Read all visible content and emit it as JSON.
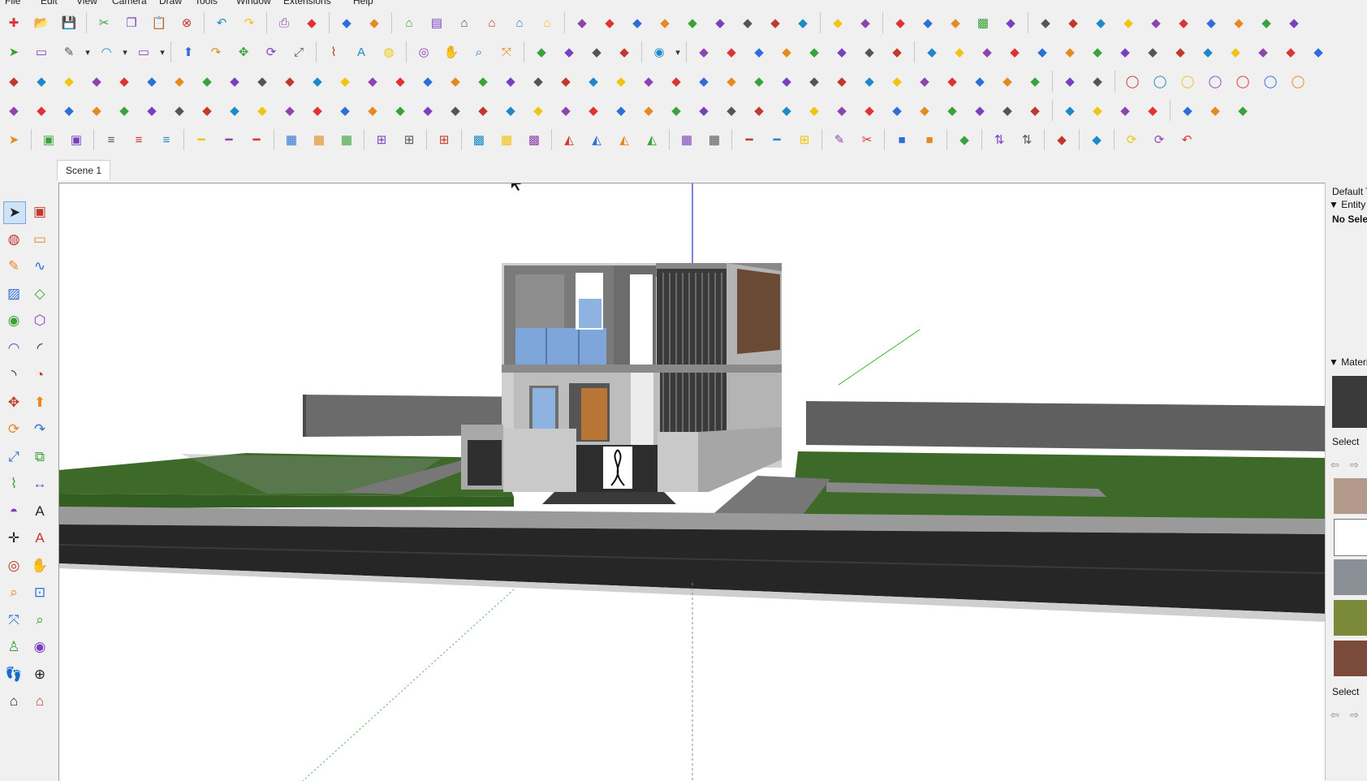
{
  "menu": [
    "File",
    "Edit",
    "View",
    "Camera",
    "Draw",
    "Tools",
    "Window",
    "Extensions",
    "Help"
  ],
  "scene_tab": "Scene 1",
  "toolbars": {
    "row1": [
      "new-file",
      "open-folder",
      "save",
      "|",
      "cut",
      "copy",
      "paste",
      "erase",
      "|",
      "undo",
      "redo",
      "|",
      "print",
      "model-info",
      "|",
      "geo-location",
      "photo-texture",
      "|",
      "iso-view",
      "top-view",
      "front-view",
      "right-view",
      "back-view",
      "left-view",
      "|",
      "extension-tool",
      "extension-tool",
      "extension-tool",
      "extension-tool",
      "extension-tool",
      "extension-tool",
      "extension-tool",
      "extension-tool",
      "extension-tool",
      "|",
      "warehouse",
      "extension-warehouse",
      "|",
      "layout",
      "style-builder",
      "solid-tools",
      "texture",
      "section",
      "|",
      "shape-tool",
      "shape-tool",
      "shape-tool",
      "shape-tool",
      "shape-tool",
      "shape-tool",
      "shape-tool",
      "shape-tool",
      "shape-tool",
      "shape-tool"
    ],
    "row2": [
      "select",
      "eraser",
      "pencil",
      "dropdown",
      "arc",
      "dropdown",
      "rectangle",
      "dropdown",
      "|",
      "push-pull",
      "follow-me",
      "move",
      "rotate",
      "scale",
      "|",
      "tape-measure",
      "text",
      "paint-bucket",
      "|",
      "orbit",
      "pan",
      "zoom",
      "zoom-extents",
      "|",
      "warehouse",
      "extension-warehouse",
      "layout",
      "ruby",
      "|",
      "user",
      "dropdown",
      "|",
      "fredo-tool",
      "fredo-tool",
      "fredo-tool",
      "fredo-tool",
      "fredo-tool",
      "fredo-tool",
      "fredo-tool",
      "fredo-tool",
      "|",
      "curve-tool",
      "curve-tool",
      "curve-tool",
      "curve-tool",
      "curve-tool",
      "curve-tool",
      "curve-tool",
      "curve-tool",
      "curve-tool",
      "curve-tool",
      "curve-tool",
      "curve-tool",
      "curve-tool",
      "curve-tool",
      "curve-tool"
    ],
    "row3": [
      "plugin",
      "plugin",
      "plugin",
      "plugin",
      "plugin",
      "plugin",
      "plugin",
      "plugin",
      "plugin",
      "plugin",
      "plugin",
      "plugin",
      "plugin",
      "plugin",
      "plugin",
      "plugin",
      "plugin",
      "plugin",
      "plugin",
      "plugin",
      "plugin",
      "plugin",
      "plugin",
      "plugin",
      "plugin",
      "plugin",
      "plugin",
      "plugin",
      "plugin",
      "plugin",
      "plugin",
      "plugin",
      "plugin",
      "plugin",
      "plugin",
      "plugin",
      "plugin",
      "plugin",
      "|",
      "plugin",
      "plugin",
      "|",
      "shape",
      "shape",
      "shape",
      "shape",
      "shape",
      "shape",
      "shape"
    ],
    "row4": [
      "plugin",
      "plugin",
      "plugin",
      "plugin",
      "plugin",
      "plugin",
      "plugin",
      "plugin",
      "plugin",
      "plugin",
      "plugin",
      "plugin",
      "plugin",
      "plugin",
      "plugin",
      "plugin",
      "plugin",
      "plugin",
      "plugin",
      "plugin",
      "plugin",
      "plugin",
      "plugin",
      "plugin",
      "plugin",
      "plugin",
      "plugin",
      "plugin",
      "plugin",
      "plugin",
      "plugin",
      "plugin",
      "plugin",
      "plugin",
      "plugin",
      "plugin",
      "plugin",
      "plugin",
      "|",
      "plugin",
      "plugin",
      "plugin",
      "plugin",
      "|",
      "plugin",
      "plugin",
      "plugin"
    ],
    "row5": [
      "select",
      "|",
      "component",
      "component",
      "|",
      "align",
      "align",
      "align",
      "|",
      "line",
      "line",
      "line",
      "|",
      "grid",
      "grid",
      "grid",
      "|",
      "window",
      "window",
      "|",
      "window",
      "|",
      "texture",
      "texture",
      "texture",
      "|",
      "mirror",
      "mirror",
      "mirror",
      "mirror",
      "|",
      "grid",
      "grid",
      "|",
      "line",
      "line",
      "window",
      "|",
      "draw",
      "cut",
      "|",
      "color",
      "color",
      "|",
      "bar",
      "|",
      "arrows",
      "arrows",
      "|",
      "tool",
      "|",
      "tool",
      "|",
      "rotate",
      "rotate",
      "undo"
    ]
  },
  "left_tools": [
    [
      "select-icon",
      "component-icon"
    ],
    [
      "paint-bucket-icon",
      "eraser-icon"
    ],
    [
      "pencil-icon",
      "freehand-icon"
    ],
    [
      "rectangle-icon",
      "rotated-rectangle-icon"
    ],
    [
      "circle-icon",
      "polygon-icon"
    ],
    [
      "arc-icon",
      "two-point-arc-icon"
    ],
    [
      "three-point-arc-icon",
      "pie-icon"
    ],
    [
      "move-icon",
      "push-pull-icon"
    ],
    [
      "rotate-icon",
      "follow-me-icon"
    ],
    [
      "scale-icon",
      "offset-icon"
    ],
    [
      "tape-measure-icon",
      "dimension-icon"
    ],
    [
      "protractor-icon",
      "text-icon"
    ],
    [
      "axes-icon",
      "3d-text-icon"
    ],
    [
      "orbit-icon",
      "pan-icon"
    ],
    [
      "zoom-icon",
      "zoom-window-icon"
    ],
    [
      "zoom-extents-icon",
      "previous-view-icon"
    ],
    [
      "position-camera-icon",
      "look-around-icon"
    ],
    [
      "walk-icon",
      "section-plane-icon"
    ],
    [
      "warehouse-icon",
      "extension-warehouse-icon"
    ]
  ],
  "tray": {
    "title": "Default Tray",
    "entity_info": "Entity Info",
    "no_selection": "No Selection",
    "materials": "Materials",
    "select1": "Select",
    "select2": "Select"
  },
  "colors": {
    "grass": "#3f6a2b",
    "road": "#2a2a2a",
    "sidewalk": "#8a8a8a",
    "wall": "#5e5e5e",
    "house": "#d4d4d4",
    "glass": "#8fb3e0",
    "door": "#b87535",
    "sky": "#ffffff"
  }
}
